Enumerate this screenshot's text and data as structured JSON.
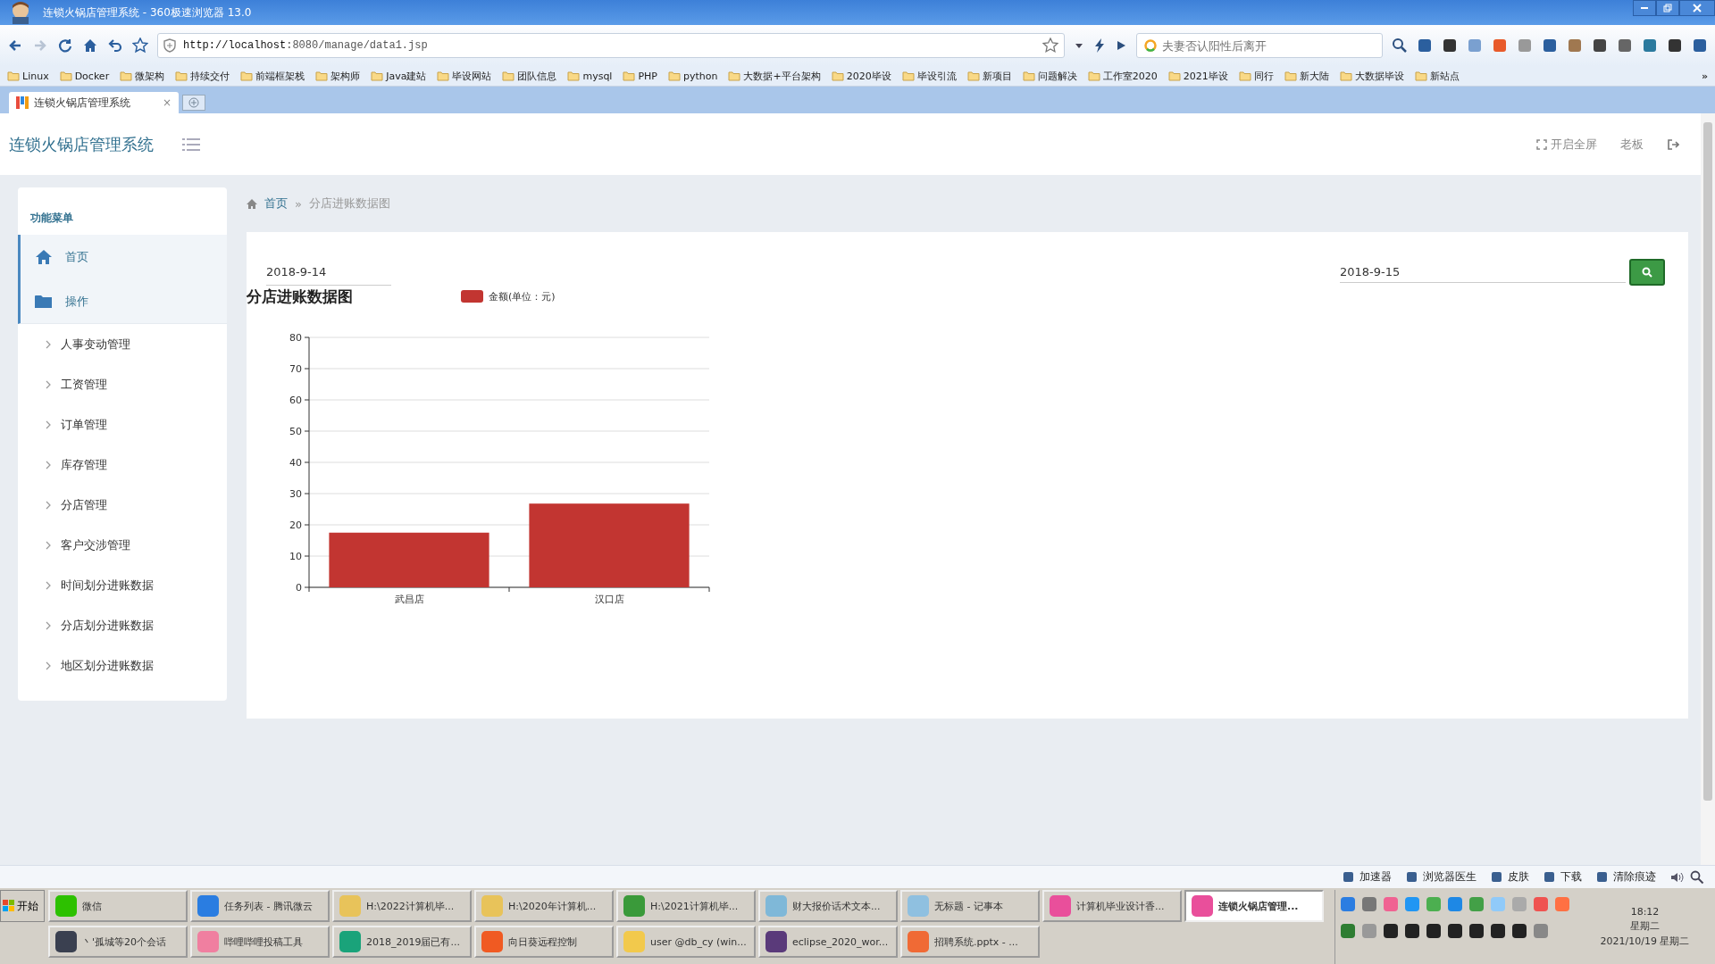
{
  "window": {
    "title": "连锁火锅店管理系统 - 360极速浏览器 13.0"
  },
  "toolbar": {
    "url_host": "http://localhost",
    "url_rest": ":8080/manage/data1.jsp",
    "search_placeholder": "夫妻否认阳性后离开"
  },
  "bookmarks": [
    "Linux",
    "Docker",
    "微架构",
    "持续交付",
    "前端框架栈",
    "架构师",
    "Java建站",
    "毕设网站",
    "团队信息",
    "mysql",
    "PHP",
    "python",
    "大数据+平台架构",
    "2020毕设",
    "毕设引流",
    "新项目",
    "问题解决",
    "工作室2020",
    "2021毕设",
    "同行",
    "新大陆",
    "大数据毕设",
    "新站点"
  ],
  "bookmarks_more": "»",
  "tabs": [
    {
      "label": "连锁火锅店管理系统",
      "selected": true,
      "close": "×"
    }
  ],
  "app": {
    "brand": "连锁火锅店管理系统",
    "fullscreen": "开启全屏",
    "user": "老板"
  },
  "sidebar": {
    "title": "功能菜单",
    "items": [
      {
        "label": "首页",
        "kind": "home",
        "selected": true
      },
      {
        "label": "操作",
        "kind": "folder",
        "selected": true,
        "expanded": true,
        "children": [
          {
            "label": "人事变动管理"
          },
          {
            "label": "工资管理"
          },
          {
            "label": "订单管理"
          },
          {
            "label": "库存管理"
          },
          {
            "label": "分店管理"
          },
          {
            "label": "客户交涉管理"
          },
          {
            "label": "时间划分进账数据"
          },
          {
            "label": "分店划分进账数据"
          },
          {
            "label": "地区划分进账数据"
          }
        ]
      }
    ]
  },
  "breadcrumb_separator": "»",
  "breadcrumb": [
    {
      "label": "首页",
      "selected": false
    },
    {
      "label": "分店进账数据图",
      "selected": true
    }
  ],
  "filters": {
    "start_date": "2018-9-14",
    "end_date": "2018-9-15"
  },
  "chart": {
    "chart_data": {
      "type": "bar",
      "title": "分店进账数据图",
      "categories": [
        "武昌店",
        "汉口店"
      ],
      "series": [
        {
          "name": "金额(单位：元)",
          "color": "#c23531",
          "values": [
            17.5,
            26.8
          ]
        }
      ],
      "ylim": [
        0,
        80
      ],
      "yticks": [
        0,
        10,
        20,
        30,
        40,
        50,
        60,
        70,
        80
      ],
      "grid": true
    }
  },
  "status_bar": [
    "加速器",
    "浏览器医生",
    "皮肤",
    "下载",
    "清除痕迹"
  ],
  "taskbar": {
    "start": "开始",
    "rows": [
      [
        {
          "label": "微信",
          "color": "#2dc100",
          "selected": false
        },
        {
          "label": "任务列表 - 腾讯微云",
          "color": "#2a7de1",
          "selected": false
        },
        {
          "label": "H:\\2022计算机毕...",
          "color": "#e8c35a",
          "selected": false
        },
        {
          "label": "H:\\2020年计算机...",
          "color": "#e8c35a",
          "selected": false
        },
        {
          "label": "H:\\2021计算机毕...",
          "color": "#3a9a3a",
          "selected": false
        },
        {
          "label": "财大报价话术文本...",
          "color": "#7fb8d8",
          "selected": false
        },
        {
          "label": "无标题 - 记事本",
          "color": "#8fc0e0",
          "selected": false
        },
        {
          "label": "计算机毕业设计香...",
          "color": "#e94f9b",
          "selected": false
        },
        {
          "label": "连锁火锅店管理...",
          "color": "#e94f9b",
          "selected": true
        }
      ],
      [
        {
          "label": "丶'孤城等20个会话",
          "color": "#3a4050",
          "selected": false
        },
        {
          "label": "哔哩哔哩投稿工具",
          "color": "#f07fa0",
          "selected": false
        },
        {
          "label": "2018_2019届已有...",
          "color": "#1aa37a",
          "selected": false
        },
        {
          "label": "向日葵远程控制",
          "color": "#f05a22",
          "selected": false
        },
        {
          "label": "user @db_cy (win...",
          "color": "#f2c94c",
          "selected": false
        },
        {
          "label": "eclipse_2020_wor...",
          "color": "#5a3a7a",
          "selected": false
        },
        {
          "label": "招聘系统.pptx - ...",
          "color": "#f06a35",
          "selected": false
        }
      ]
    ],
    "time": "18:12",
    "weekday": "星期二",
    "date": "2021/10/19 星期二"
  }
}
